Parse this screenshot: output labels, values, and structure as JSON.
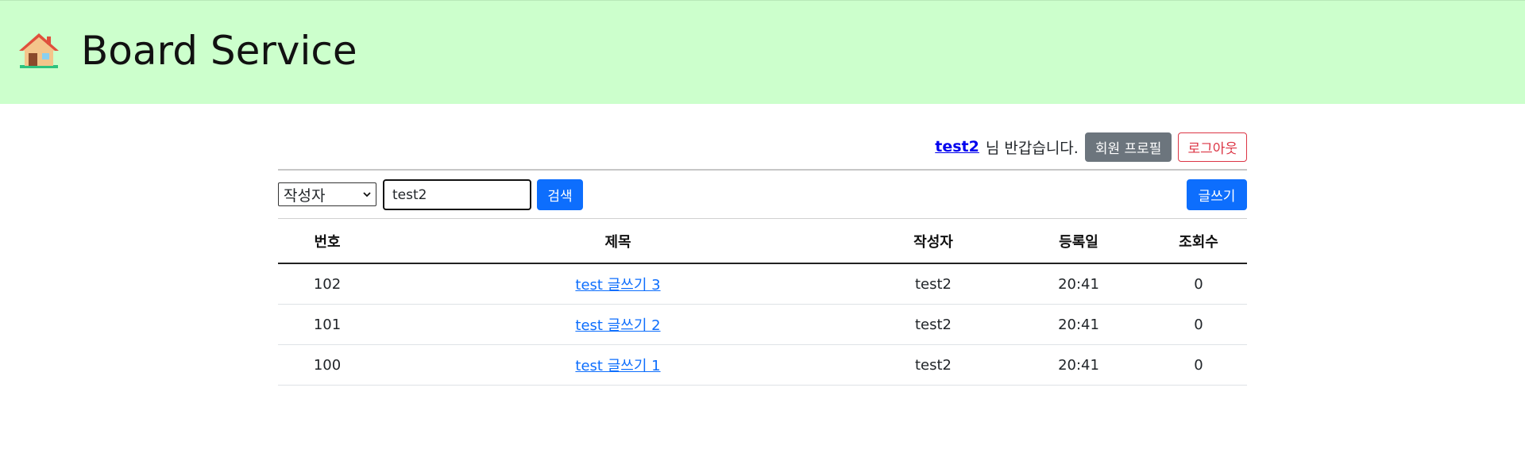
{
  "header": {
    "title": "Board Service",
    "logo_icon": "house-icon",
    "background": "#ccffcc"
  },
  "userbar": {
    "username": "test2",
    "greeting": "님 반갑습니다.",
    "profile_label": "회원 프로필",
    "logout_label": "로그아웃"
  },
  "search": {
    "field_selected": "작성자",
    "query": "test2",
    "search_label": "검색",
    "write_label": "글쓰기"
  },
  "table": {
    "columns": [
      "번호",
      "제목",
      "작성자",
      "등록일",
      "조회수"
    ],
    "rows": [
      {
        "no": "102",
        "title": "test 글쓰기 3",
        "writer": "test2",
        "date": "20:41",
        "views": "0"
      },
      {
        "no": "101",
        "title": "test 글쓰기 2",
        "writer": "test2",
        "date": "20:41",
        "views": "0"
      },
      {
        "no": "100",
        "title": "test 글쓰기 1",
        "writer": "test2",
        "date": "20:41",
        "views": "0"
      }
    ]
  },
  "colors": {
    "primary": "#0d6efd",
    "secondary": "#6c757d",
    "danger": "#dc3545"
  }
}
